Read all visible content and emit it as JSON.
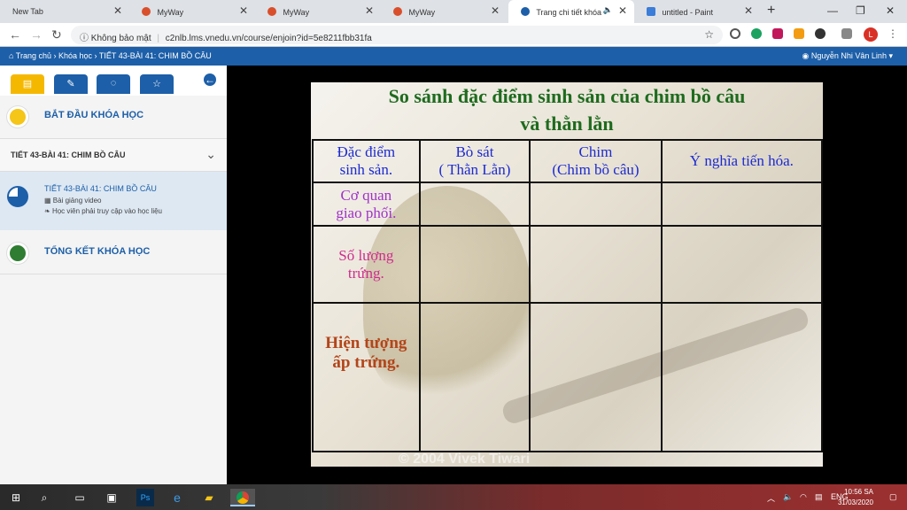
{
  "browser": {
    "tabs": [
      {
        "label": "New Tab"
      },
      {
        "label": "MyWay"
      },
      {
        "label": "MyWay"
      },
      {
        "label": "MyWay"
      },
      {
        "label": "Trang chi tiết khóa"
      },
      {
        "label": "untitled - Paint"
      }
    ],
    "url_security": "Không bảo mật",
    "url": "c2nlb.lms.vnedu.vn/course/enjoin?id=5e8211fbb31fa",
    "profile_initial": "L"
  },
  "breadcrumb": {
    "home": "Trang chủ",
    "courses": "Khóa học",
    "current": "TIẾT 43-BÀI 41: CHIM BỒ CÂU",
    "user": "Nguyễn Nhi Vân Linh"
  },
  "sidebar": {
    "start": "BẮT ĐẦU KHÓA HỌC",
    "section": "TIẾT 43-BÀI 41: CHIM BỒ CÂU",
    "lesson_title": "TIẾT 43-BÀI 41: CHIM BỒ CÂU",
    "lesson_type": "Bài giảng video",
    "lesson_note": "Học viên phải truy cập vào học liệu",
    "summary": "TỔNG KẾT KHÓA HỌC"
  },
  "slide": {
    "title_line1": "So sánh đặc điểm sinh sản của chim bồ câu",
    "title_line2": "và thằn lằn",
    "header": {
      "c1_l1": "Đặc điểm",
      "c1_l2": "sinh sản.",
      "c2_l1": "Bò sát",
      "c2_l2": "( Thằn Lằn)",
      "c3_l1": "Chim",
      "c3_l2": "(Chim bồ câu)",
      "c4": "Ý nghĩa tiến hóa."
    },
    "rows": {
      "r1_l1": "Cơ quan",
      "r1_l2": "giao phối.",
      "r2_l1": "Số lượng",
      "r2_l2": "trứng.",
      "r3_l1": "Hiện tượng",
      "r3_l2": "ấp trứng."
    },
    "watermark": "© 2004 Vivek Tiwari"
  },
  "taskbar": {
    "lang": "ENG",
    "time": "10:56 SA",
    "date": "31/03/2020"
  }
}
